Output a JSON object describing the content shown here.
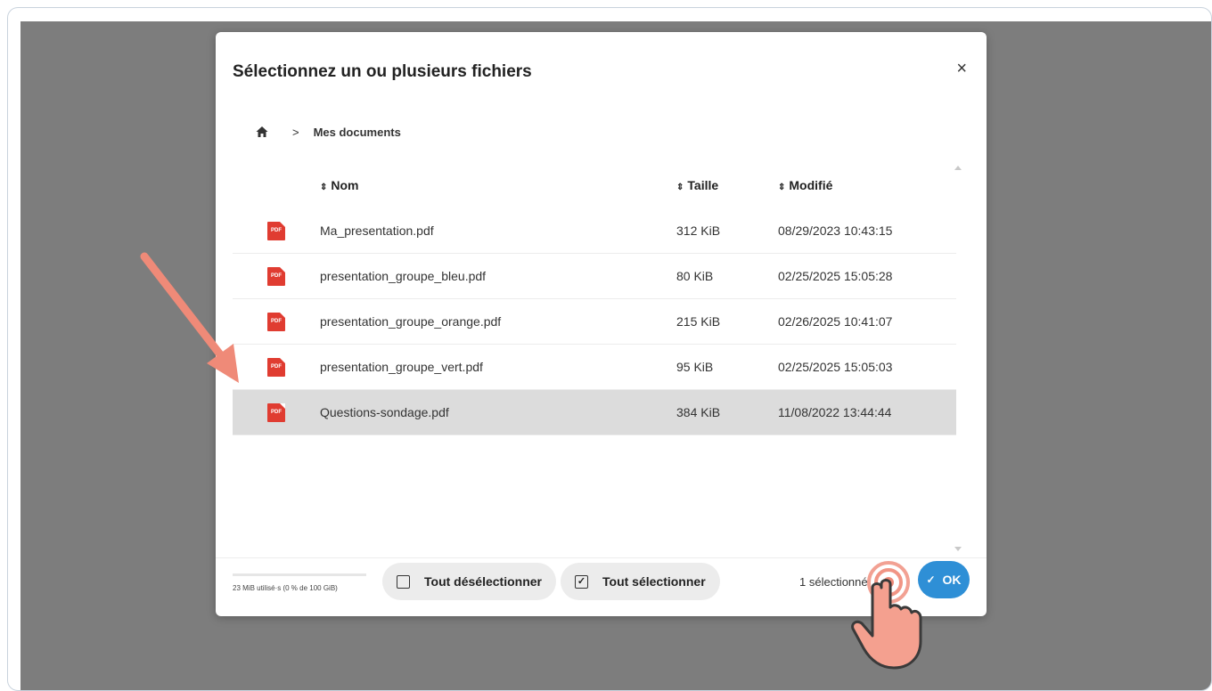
{
  "dialog": {
    "title": "Sélectionnez un ou plusieurs fichiers",
    "close": "×"
  },
  "breadcrumb": {
    "sep": ">",
    "folder": "Mes documents"
  },
  "table": {
    "sort_glyph": "⇕",
    "headers": {
      "name": "Nom",
      "size": "Taille",
      "modified": "Modifié"
    },
    "rows": [
      {
        "icon": "PDF",
        "name": "Ma_presentation.pdf",
        "size": "312 KiB",
        "modified": "08/29/2023 10:43:15"
      },
      {
        "icon": "PDF",
        "name": "presentation_groupe_bleu.pdf",
        "size": "80 KiB",
        "modified": "02/25/2025 15:05:28"
      },
      {
        "icon": "PDF",
        "name": "presentation_groupe_orange.pdf",
        "size": "215 KiB",
        "modified": "02/26/2025 10:41:07"
      },
      {
        "icon": "PDF",
        "name": "presentation_groupe_vert.pdf",
        "size": "95 KiB",
        "modified": "02/25/2025 15:05:03"
      },
      {
        "icon": "PDF",
        "name": "Questions-sondage.pdf",
        "size": "384 KiB",
        "modified": "11/08/2022 13:44:44"
      }
    ],
    "selected_index": 4
  },
  "footer": {
    "quota": "23 MiB utilisé·s (0 % de 100 GiB)",
    "quota_fraction": 0.0,
    "deselect_all": "Tout désélectionner",
    "select_all": "Tout sélectionner",
    "select_all_check": "✓",
    "selection_count": "1 sélectionné",
    "ok": "OK",
    "ok_check": "✓"
  },
  "colors": {
    "accent": "#2e8fd6",
    "pdf": "#e03c31",
    "annotation": "#ef8a78",
    "backdrop": "#7d7d7d"
  }
}
